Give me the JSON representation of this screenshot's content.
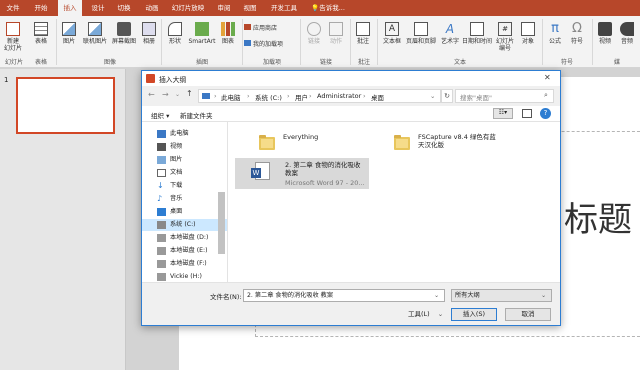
{
  "ribbon": {
    "tabs": [
      "文件",
      "开始",
      "插入",
      "设计",
      "切换",
      "动画",
      "幻灯片放映",
      "审阅",
      "视图",
      "开发工具",
      "告诉我..."
    ],
    "active_tab": "插入",
    "buttons": {
      "new_slide": "新建\n幻灯片",
      "table": "表格",
      "picture": "图片",
      "online_picture": "联机图片",
      "screenshot": "屏幕截图",
      "album": "相册",
      "shapes": "形状",
      "smartart": "SmartArt",
      "chart": "图表",
      "store": "应用商店",
      "my_addins": "我的加载项",
      "link": "链接",
      "action": "动作",
      "comment": "批注",
      "textbox": "文本框",
      "header_footer": "页眉和页脚",
      "wordart": "艺术字",
      "datetime": "日期和时间",
      "slide_number": "幻灯片\n编号",
      "object": "对象",
      "equation": "公式",
      "symbol": "符号",
      "video": "视频",
      "audio": "音频"
    },
    "groups": {
      "slides": "幻灯片",
      "tables": "表格",
      "images": "图像",
      "illustrations": "插图",
      "addins": "加载项",
      "links": "链接",
      "comments": "批注",
      "text": "文本",
      "symbols": "符号",
      "media": "媒"
    }
  },
  "slides_panel": {
    "number": "1"
  },
  "slide": {
    "title_placeholder": "标题"
  },
  "dialog": {
    "title": "插入大纲",
    "close": "✕",
    "breadcrumb": [
      "此电脑",
      "系统 (C:)",
      "用户",
      "Administrator",
      "桌面"
    ],
    "search_placeholder": "搜索\"桌面\"",
    "organize": "组织 ▾",
    "new_folder": "新建文件夹",
    "nav_items": [
      "此电脑",
      "视频",
      "图片",
      "文档",
      "下载",
      "音乐",
      "桌面",
      "系统 (C:)",
      "本地磁盘 (D:)",
      "本地磁盘 (E:)",
      "本地磁盘 (F:)",
      "Vickie (H:)"
    ],
    "selected_nav": "系统 (C:)",
    "files": [
      {
        "name": "Everything",
        "type": "folder"
      },
      {
        "name": "FSCapture v8.4 绿色有蓝天汉化版",
        "type": "folder"
      },
      {
        "name": "2. 第二章 食物的消化吸收教案",
        "subtitle": "Microsoft Word 97 - 20...",
        "type": "word"
      }
    ],
    "filename_label": "文件名(N):",
    "filename_value": "2. 第二章 食物的消化吸收 教案",
    "filetype": "所有大纲",
    "tools": "工具(L)",
    "insert": "插入(S)",
    "cancel": "取消"
  },
  "colors": {
    "accent": "#b7472a",
    "selection": "#cce8ff",
    "dialog_border": "#2d7dd2"
  }
}
